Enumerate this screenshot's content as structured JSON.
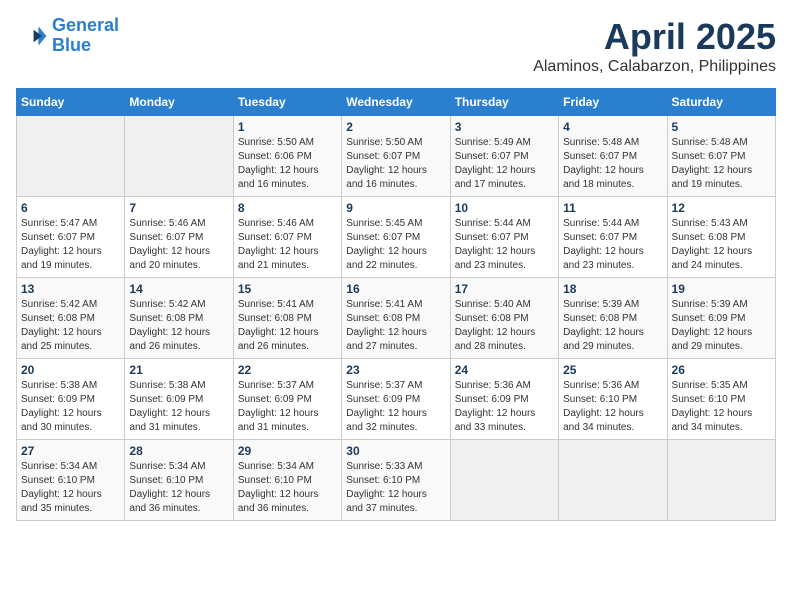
{
  "logo": {
    "line1": "General",
    "line2": "Blue"
  },
  "title": "April 2025",
  "location": "Alaminos, Calabarzon, Philippines",
  "days_of_week": [
    "Sunday",
    "Monday",
    "Tuesday",
    "Wednesday",
    "Thursday",
    "Friday",
    "Saturday"
  ],
  "weeks": [
    [
      {
        "day": "",
        "info": ""
      },
      {
        "day": "",
        "info": ""
      },
      {
        "day": "1",
        "info": "Sunrise: 5:50 AM\nSunset: 6:06 PM\nDaylight: 12 hours\nand 16 minutes."
      },
      {
        "day": "2",
        "info": "Sunrise: 5:50 AM\nSunset: 6:07 PM\nDaylight: 12 hours\nand 16 minutes."
      },
      {
        "day": "3",
        "info": "Sunrise: 5:49 AM\nSunset: 6:07 PM\nDaylight: 12 hours\nand 17 minutes."
      },
      {
        "day": "4",
        "info": "Sunrise: 5:48 AM\nSunset: 6:07 PM\nDaylight: 12 hours\nand 18 minutes."
      },
      {
        "day": "5",
        "info": "Sunrise: 5:48 AM\nSunset: 6:07 PM\nDaylight: 12 hours\nand 19 minutes."
      }
    ],
    [
      {
        "day": "6",
        "info": "Sunrise: 5:47 AM\nSunset: 6:07 PM\nDaylight: 12 hours\nand 19 minutes."
      },
      {
        "day": "7",
        "info": "Sunrise: 5:46 AM\nSunset: 6:07 PM\nDaylight: 12 hours\nand 20 minutes."
      },
      {
        "day": "8",
        "info": "Sunrise: 5:46 AM\nSunset: 6:07 PM\nDaylight: 12 hours\nand 21 minutes."
      },
      {
        "day": "9",
        "info": "Sunrise: 5:45 AM\nSunset: 6:07 PM\nDaylight: 12 hours\nand 22 minutes."
      },
      {
        "day": "10",
        "info": "Sunrise: 5:44 AM\nSunset: 6:07 PM\nDaylight: 12 hours\nand 23 minutes."
      },
      {
        "day": "11",
        "info": "Sunrise: 5:44 AM\nSunset: 6:07 PM\nDaylight: 12 hours\nand 23 minutes."
      },
      {
        "day": "12",
        "info": "Sunrise: 5:43 AM\nSunset: 6:08 PM\nDaylight: 12 hours\nand 24 minutes."
      }
    ],
    [
      {
        "day": "13",
        "info": "Sunrise: 5:42 AM\nSunset: 6:08 PM\nDaylight: 12 hours\nand 25 minutes."
      },
      {
        "day": "14",
        "info": "Sunrise: 5:42 AM\nSunset: 6:08 PM\nDaylight: 12 hours\nand 26 minutes."
      },
      {
        "day": "15",
        "info": "Sunrise: 5:41 AM\nSunset: 6:08 PM\nDaylight: 12 hours\nand 26 minutes."
      },
      {
        "day": "16",
        "info": "Sunrise: 5:41 AM\nSunset: 6:08 PM\nDaylight: 12 hours\nand 27 minutes."
      },
      {
        "day": "17",
        "info": "Sunrise: 5:40 AM\nSunset: 6:08 PM\nDaylight: 12 hours\nand 28 minutes."
      },
      {
        "day": "18",
        "info": "Sunrise: 5:39 AM\nSunset: 6:08 PM\nDaylight: 12 hours\nand 29 minutes."
      },
      {
        "day": "19",
        "info": "Sunrise: 5:39 AM\nSunset: 6:09 PM\nDaylight: 12 hours\nand 29 minutes."
      }
    ],
    [
      {
        "day": "20",
        "info": "Sunrise: 5:38 AM\nSunset: 6:09 PM\nDaylight: 12 hours\nand 30 minutes."
      },
      {
        "day": "21",
        "info": "Sunrise: 5:38 AM\nSunset: 6:09 PM\nDaylight: 12 hours\nand 31 minutes."
      },
      {
        "day": "22",
        "info": "Sunrise: 5:37 AM\nSunset: 6:09 PM\nDaylight: 12 hours\nand 31 minutes."
      },
      {
        "day": "23",
        "info": "Sunrise: 5:37 AM\nSunset: 6:09 PM\nDaylight: 12 hours\nand 32 minutes."
      },
      {
        "day": "24",
        "info": "Sunrise: 5:36 AM\nSunset: 6:09 PM\nDaylight: 12 hours\nand 33 minutes."
      },
      {
        "day": "25",
        "info": "Sunrise: 5:36 AM\nSunset: 6:10 PM\nDaylight: 12 hours\nand 34 minutes."
      },
      {
        "day": "26",
        "info": "Sunrise: 5:35 AM\nSunset: 6:10 PM\nDaylight: 12 hours\nand 34 minutes."
      }
    ],
    [
      {
        "day": "27",
        "info": "Sunrise: 5:34 AM\nSunset: 6:10 PM\nDaylight: 12 hours\nand 35 minutes."
      },
      {
        "day": "28",
        "info": "Sunrise: 5:34 AM\nSunset: 6:10 PM\nDaylight: 12 hours\nand 36 minutes."
      },
      {
        "day": "29",
        "info": "Sunrise: 5:34 AM\nSunset: 6:10 PM\nDaylight: 12 hours\nand 36 minutes."
      },
      {
        "day": "30",
        "info": "Sunrise: 5:33 AM\nSunset: 6:10 PM\nDaylight: 12 hours\nand 37 minutes."
      },
      {
        "day": "",
        "info": ""
      },
      {
        "day": "",
        "info": ""
      },
      {
        "day": "",
        "info": ""
      }
    ]
  ]
}
